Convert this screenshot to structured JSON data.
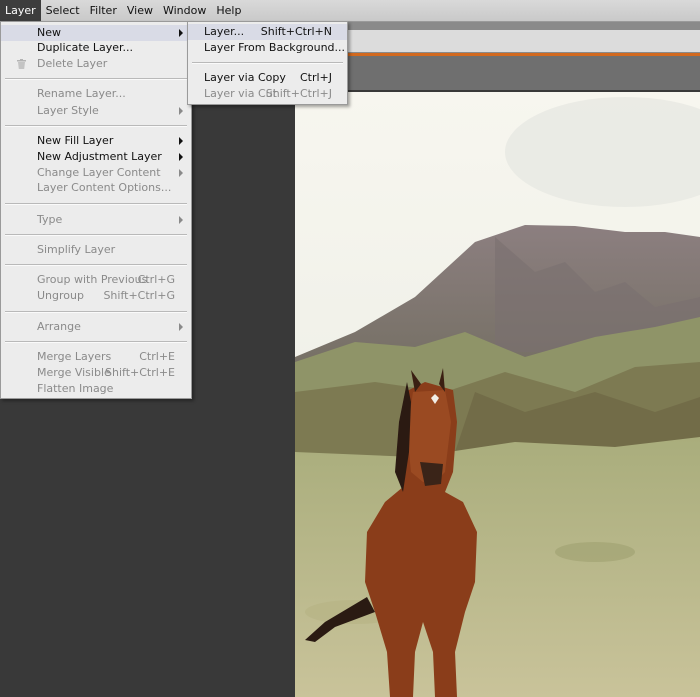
{
  "menubar": {
    "items": [
      {
        "label": "Layer",
        "active": true
      },
      {
        "label": "Select"
      },
      {
        "label": "Filter"
      },
      {
        "label": "View"
      },
      {
        "label": "Window"
      },
      {
        "label": "Help"
      }
    ]
  },
  "layer_menu": {
    "new": "New",
    "duplicate_layer": "Duplicate Layer...",
    "delete_layer": "Delete Layer",
    "rename_layer": "Rename Layer...",
    "layer_style": "Layer Style",
    "new_fill_layer": "New Fill Layer",
    "new_adjustment_layer": "New Adjustment Layer",
    "change_layer_content": "Change Layer Content",
    "layer_content_options": "Layer Content Options...",
    "type": "Type",
    "simplify_layer": "Simplify Layer",
    "group_with_previous": "Group with Previous",
    "group_with_previous_sc": "Ctrl+G",
    "ungroup": "Ungroup",
    "ungroup_sc": "Shift+Ctrl+G",
    "arrange": "Arrange",
    "merge_layers": "Merge Layers",
    "merge_layers_sc": "Ctrl+E",
    "merge_visible": "Merge Visible",
    "merge_visible_sc": "Shift+Ctrl+E",
    "flatten_image": "Flatten Image"
  },
  "new_submenu": {
    "layer": "Layer...",
    "layer_sc": "Shift+Ctrl+N",
    "layer_from_background": "Layer From Background...",
    "layer_via_copy": "Layer via Copy",
    "layer_via_copy_sc": "Ctrl+J",
    "layer_via_cut": "Layer via Cut",
    "layer_via_cut_sc": "Shift+Ctrl+J"
  },
  "colors": {
    "accent_bar": "#d2691e",
    "menu_bg": "#ececec",
    "highlight": "#d9dbe6"
  }
}
